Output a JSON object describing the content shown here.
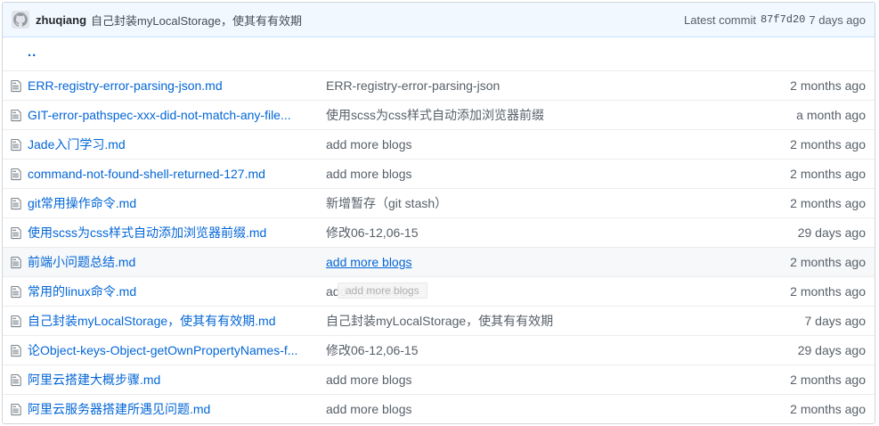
{
  "commit": {
    "author": "zhuqiang",
    "message": "自己封装myLocalStorage，使其有有效期",
    "latest_label": "Latest commit",
    "sha": "87f7d20",
    "age": "7 days ago"
  },
  "parent_dir": {
    "label": ".."
  },
  "files": [
    {
      "name": "ERR-registry-error-parsing-json.md",
      "message": "ERR-registry-error-parsing-json",
      "age": "2 months ago"
    },
    {
      "name": "GIT-error-pathspec-xxx-did-not-match-any-file...",
      "message": "使用scss为css样式自动添加浏览器前缀",
      "age": "a month ago"
    },
    {
      "name": "Jade入门学习.md",
      "message": "add more blogs",
      "age": "2 months ago"
    },
    {
      "name": "command-not-found-shell-returned-127.md",
      "message": "add more blogs",
      "age": "2 months ago"
    },
    {
      "name": "git常用操作命令.md",
      "message": "新增暂存（git stash）",
      "age": "2 months ago"
    },
    {
      "name": "使用scss为css样式自动添加浏览器前缀.md",
      "message": "修改06-12,06-15",
      "age": "29 days ago"
    },
    {
      "name": "前端小问题总结.md",
      "message": "add more blogs",
      "age": "2 months ago"
    },
    {
      "name": "常用的linux命令.md",
      "message": "add more blogs",
      "age": "2 months ago"
    },
    {
      "name": "自己封装myLocalStorage，使其有有效期.md",
      "message": "自己封装myLocalStorage，使其有有效期",
      "age": "7 days ago"
    },
    {
      "name": "论Object-keys-Object-getOwnPropertyNames-f...",
      "message": "修改06-12,06-15",
      "age": "29 days ago"
    },
    {
      "name": "阿里云搭建大概步骤.md",
      "message": "add more blogs",
      "age": "2 months ago"
    },
    {
      "name": "阿里云服务器搭建所遇见问题.md",
      "message": "add more blogs",
      "age": "2 months ago"
    }
  ],
  "tooltip": {
    "text": "add more blogs"
  },
  "icons": {
    "avatar": "github-avatar-icon",
    "file": "file-text-icon"
  },
  "colors": {
    "link": "#0366d6",
    "commit_bar": "#f1f8ff",
    "muted": "#586069"
  }
}
